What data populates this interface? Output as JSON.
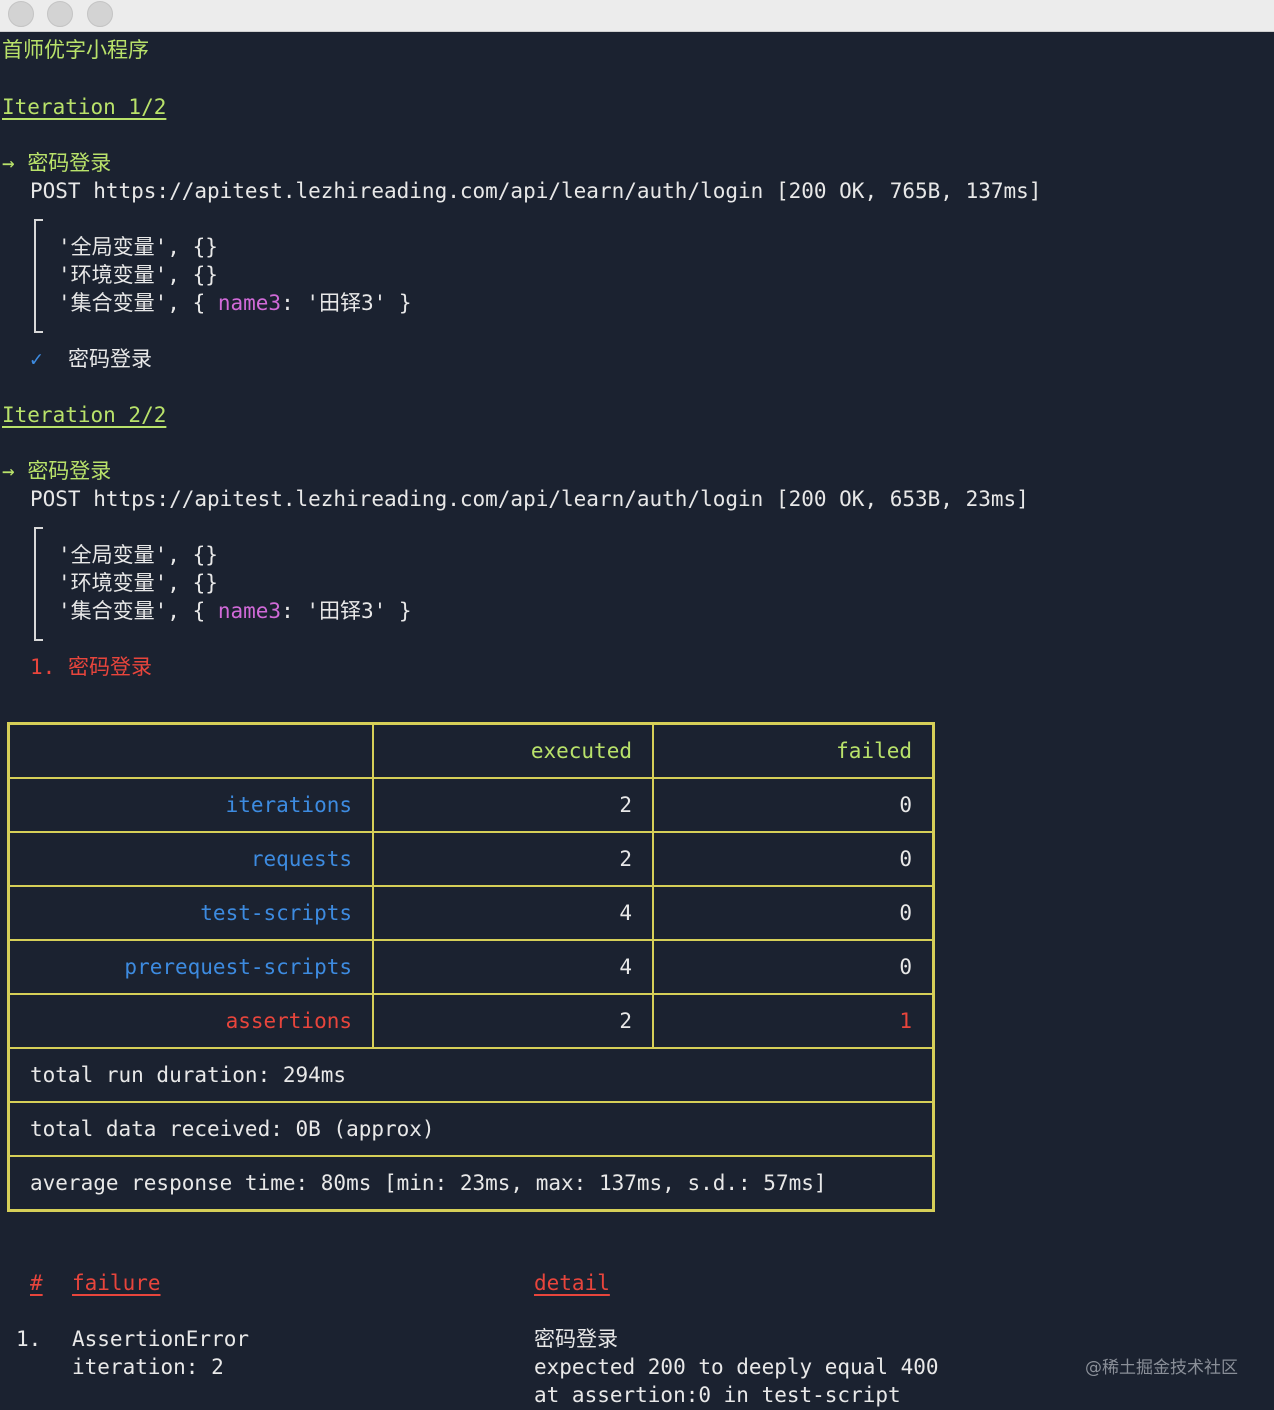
{
  "window": {
    "buttons": [
      "close",
      "minimize",
      "zoom"
    ]
  },
  "header": {
    "title": "首师优字小程序"
  },
  "iterations": [
    {
      "heading": "Iteration 1/2",
      "arrow": "→",
      "request_name": "密码登录",
      "request_line": "POST https://apitest.lezhireading.com/api/learn/auth/login [200 OK, 765B, 137ms]",
      "log": {
        "global": "'全局变量', {}",
        "env": "'环境变量', {}",
        "collection_prefix": "'集合变量', { ",
        "collection_key": "name3",
        "collection_suffix": ": '田铎3' }"
      },
      "result_mark": "✓",
      "result_name": "密码登录"
    },
    {
      "heading": "Iteration 2/2",
      "arrow": "→",
      "request_name": "密码登录",
      "request_line": "POST https://apitest.lezhireading.com/api/learn/auth/login [200 OK, 653B, 23ms]",
      "log": {
        "global": "'全局变量', {}",
        "env": "'环境变量', {}",
        "collection_prefix": "'集合变量', { ",
        "collection_key": "name3",
        "collection_suffix": ": '田铎3' }"
      },
      "result_mark": "1.",
      "result_name": "密码登录"
    }
  ],
  "summary": {
    "headers": [
      "",
      "executed",
      "failed"
    ],
    "rows": [
      {
        "label": "iterations",
        "executed": "2",
        "failed": "0"
      },
      {
        "label": "requests",
        "executed": "2",
        "failed": "0"
      },
      {
        "label": "test-scripts",
        "executed": "4",
        "failed": "0"
      },
      {
        "label": "prerequest-scripts",
        "executed": "4",
        "failed": "0"
      },
      {
        "label": "assertions",
        "executed": "2",
        "failed": "1"
      }
    ],
    "duration": "total run duration: 294ms",
    "data_received": "total data received: 0B (approx)",
    "response_time": "average response time: 80ms [min: 23ms, max: 137ms, s.d.: 57ms]"
  },
  "failures": {
    "col_num": "#",
    "col_failure": "failure",
    "col_detail": "detail",
    "items": [
      {
        "num": "1.",
        "type": "AssertionError",
        "iteration": "iteration: 2",
        "detail_title": "密码登录",
        "detail_line1": "expected 200 to deeply equal 400",
        "detail_line2": "at assertion:0 in test-script"
      }
    ]
  },
  "watermark": "@稀土掘金技术社区",
  "colors": {
    "background": "#1b2230",
    "green": "#b9e26a",
    "blue": "#3d8be0",
    "red": "#e8453c",
    "magenta": "#d16ad8",
    "table_border": "#d6cf58"
  }
}
